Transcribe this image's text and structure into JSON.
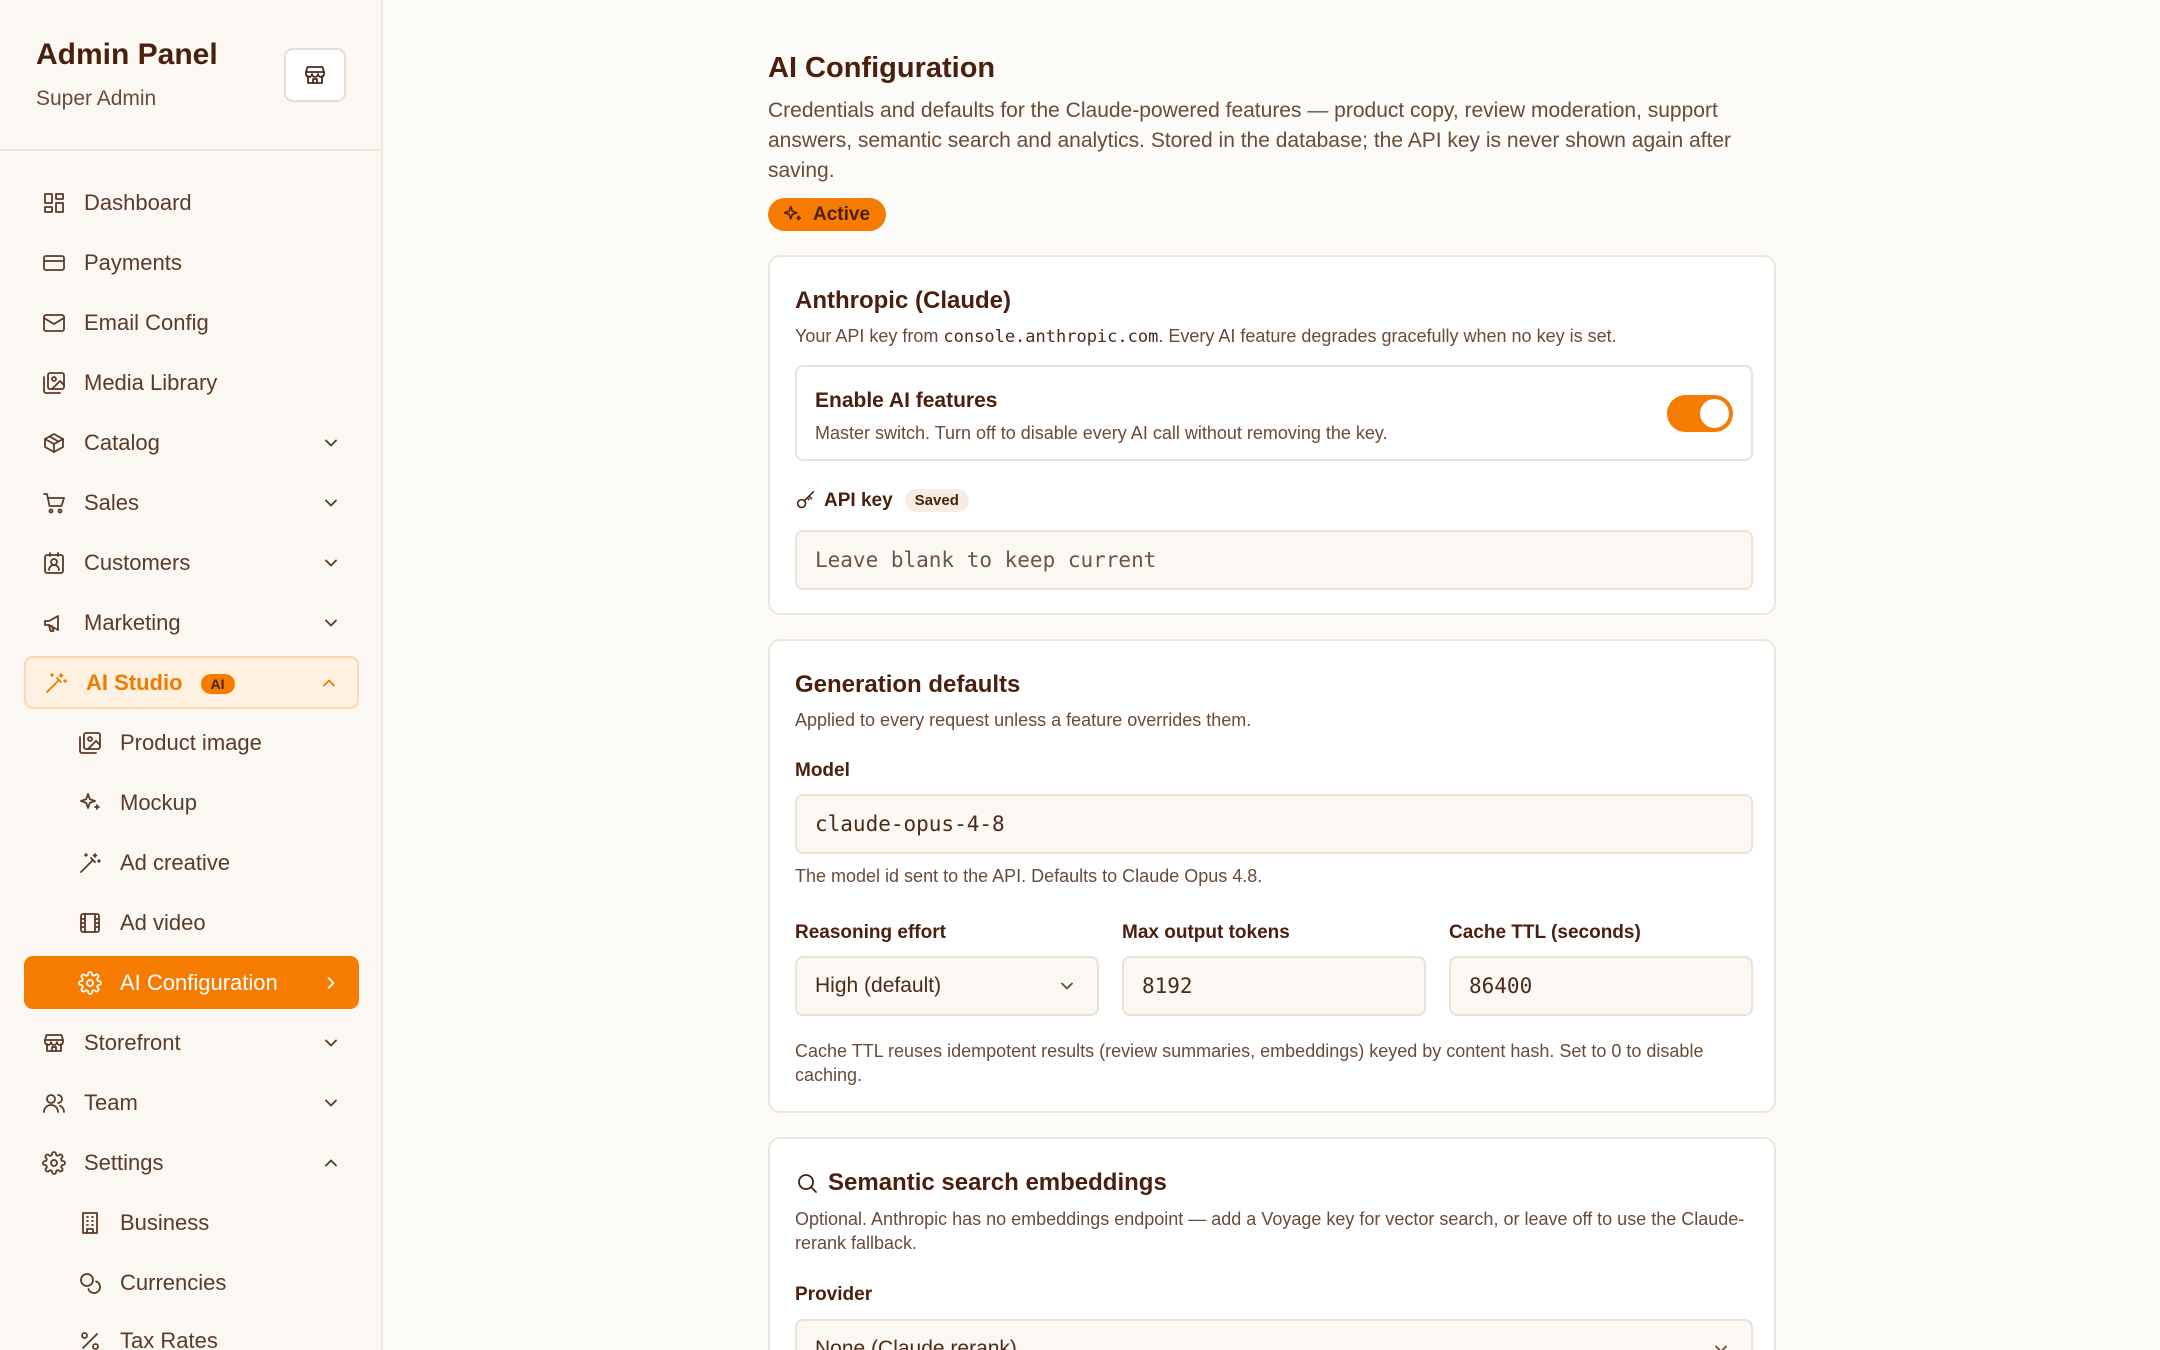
{
  "sidebar": {
    "title": "Admin Panel",
    "subtitle": "Super Admin",
    "store_icon": "store-icon",
    "items": [
      {
        "label": "Dashboard",
        "icon": "dashboard-icon"
      },
      {
        "label": "Payments",
        "icon": "credit-card-icon"
      },
      {
        "label": "Email Config",
        "icon": "mail-icon"
      },
      {
        "label": "Media Library",
        "icon": "images-icon"
      },
      {
        "label": "Catalog",
        "icon": "package-icon"
      },
      {
        "label": "Sales",
        "icon": "cart-icon"
      },
      {
        "label": "Customers",
        "icon": "contact-icon"
      },
      {
        "label": "Marketing",
        "icon": "megaphone-icon"
      },
      {
        "label": "AI Studio",
        "icon": "magic-wand-icon",
        "badge": "AI"
      },
      {
        "label": "Product image",
        "icon": "images-icon"
      },
      {
        "label": "Mockup",
        "icon": "sparkles-icon"
      },
      {
        "label": "Ad creative",
        "icon": "magic-wand-icon"
      },
      {
        "label": "Ad video",
        "icon": "film-icon"
      },
      {
        "label": "AI Configuration",
        "icon": "gear-icon"
      },
      {
        "label": "Storefront",
        "icon": "store-icon"
      },
      {
        "label": "Team",
        "icon": "users-icon"
      },
      {
        "label": "Settings",
        "icon": "gear-icon"
      },
      {
        "label": "Business",
        "icon": "building-icon"
      },
      {
        "label": "Currencies",
        "icon": "coins-icon"
      },
      {
        "label": "Tax Rates",
        "icon": "percent-icon"
      }
    ]
  },
  "page": {
    "title": "AI Configuration",
    "description": "Credentials and defaults for the Claude-powered features — product copy, review moderation, support answers, semantic search and analytics. Stored in the database; the API key is never shown again after saving.",
    "status": "Active"
  },
  "anthropic": {
    "title": "Anthropic (Claude)",
    "desc_prefix": "Your API key from ",
    "desc_code": "console.anthropic.com",
    "desc_suffix": ". Every AI feature degrades gracefully when no key is set.",
    "toggle_title": "Enable AI features",
    "toggle_desc": "Master switch. Turn off to disable every AI call without removing the key.",
    "toggle_on": true,
    "api_key_label": "API key",
    "api_key_badge": "Saved",
    "api_key_placeholder": "Leave blank to keep current"
  },
  "generation": {
    "title": "Generation defaults",
    "desc": "Applied to every request unless a feature overrides them.",
    "model_label": "Model",
    "model_value": "claude-opus-4-8",
    "model_help": "The model id sent to the API. Defaults to Claude Opus 4.8.",
    "effort_label": "Reasoning effort",
    "effort_value": "High (default)",
    "tokens_label": "Max output tokens",
    "tokens_value": "8192",
    "ttl_label": "Cache TTL (seconds)",
    "ttl_value": "86400",
    "ttl_help": "Cache TTL reuses idempotent results (review summaries, embeddings) keyed by content hash. Set to 0 to disable caching."
  },
  "embeddings": {
    "title": "Semantic search embeddings",
    "desc": "Optional. Anthropic has no embeddings endpoint — add a Voyage key for vector search, or leave off to use the Claude-rerank fallback.",
    "provider_label": "Provider",
    "provider_value": "None (Claude rerank)"
  },
  "colors": {
    "accent": "#f57c00",
    "text_dark": "#4a1f0d",
    "text_muted": "#6a4a38",
    "sidebar_bg": "#fbf7f2"
  }
}
